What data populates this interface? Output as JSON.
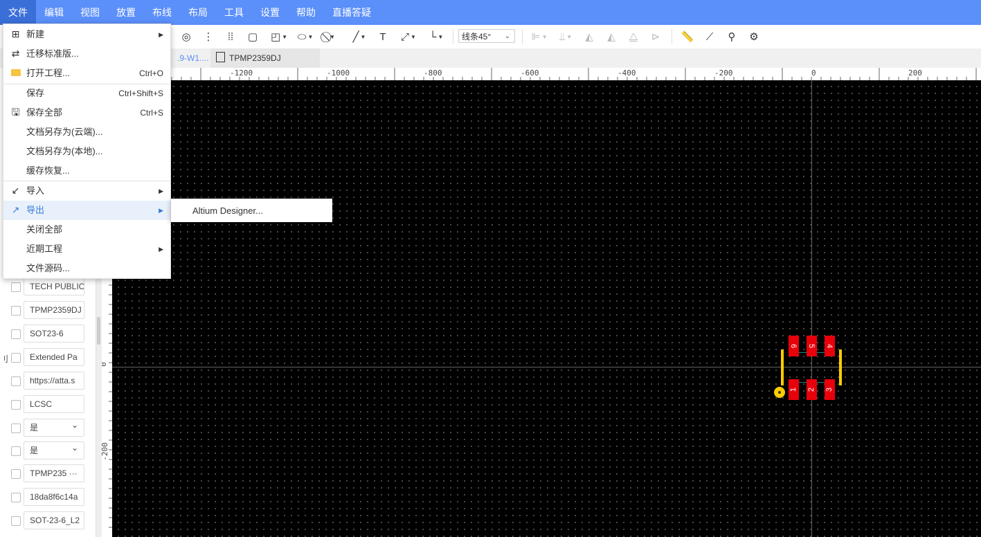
{
  "menubar": [
    "文件",
    "编辑",
    "视图",
    "放置",
    "布线",
    "布局",
    "工具",
    "设置",
    "帮助",
    "直播答疑"
  ],
  "toolbar": {
    "line_mode": "线条45°"
  },
  "tabs": [
    {
      "label": ".9-W1...."
    },
    {
      "label": "TPMP2359DJ"
    }
  ],
  "ruler_h": [
    "-1200",
    "-1000",
    "-800",
    "-600",
    "-400",
    "-200",
    "0",
    "200"
  ],
  "ruler_v": [
    "0",
    "-200"
  ],
  "file_menu": {
    "new": "新建",
    "migrate": "迁移标准版...",
    "open_project": "打开工程...",
    "open_project_sc": "Ctrl+O",
    "save": "保存",
    "save_sc": "Ctrl+Shift+S",
    "save_all": "保存全部",
    "save_all_sc": "Ctrl+S",
    "save_as_cloud": "文档另存为(云端)...",
    "save_as_local": "文档另存为(本地)...",
    "cache_restore": "缓存恢复...",
    "import": "导入",
    "export": "导出",
    "close_all": "关闭全部",
    "recent": "近期工程",
    "source": "文件源码..."
  },
  "export_submenu": {
    "altium": "Altium Designer..."
  },
  "properties": {
    "side_char": "刂",
    "fields": [
      "TECH PUBLIC",
      "TPMP2359DJ",
      "SOT23-6",
      "Extended Pa",
      "https://atta.s",
      "LCSC",
      "是",
      "是",
      "TPMP235 ···",
      "18da8f6c14a",
      "SOT-23-6_L2"
    ]
  },
  "pads": [
    "1",
    "2",
    "3",
    "4",
    "5",
    "6"
  ]
}
